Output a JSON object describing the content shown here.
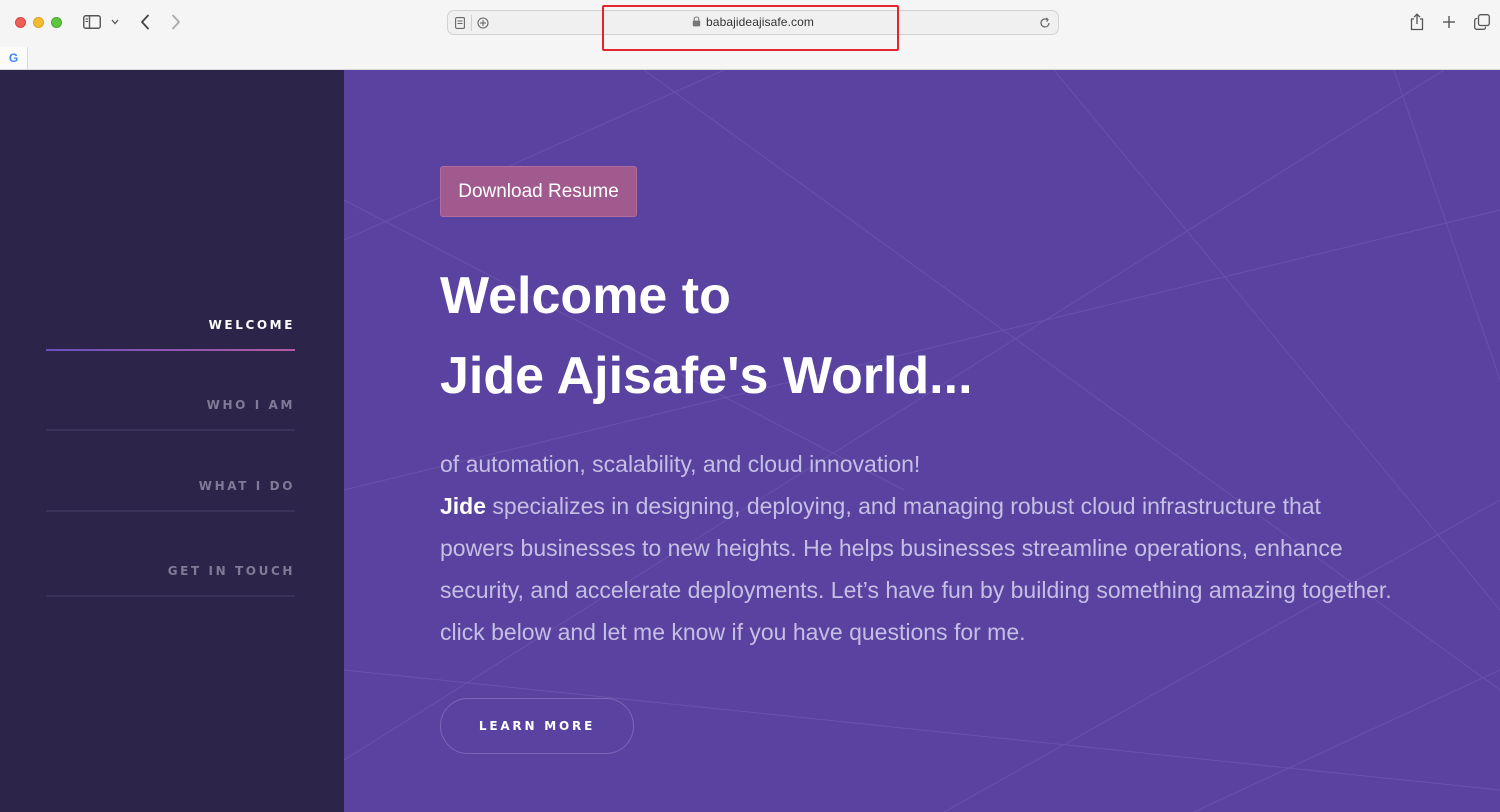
{
  "browser": {
    "url": "babajideajisafe.com",
    "favicon_letter": "G"
  },
  "sidebar": {
    "items": [
      {
        "label": "WELCOME",
        "active": true
      },
      {
        "label": "WHO I AM",
        "active": false
      },
      {
        "label": "WHAT I DO",
        "active": false
      },
      {
        "label": "GET IN TOUCH",
        "active": false
      }
    ]
  },
  "hero": {
    "resume_button": "Download Resume",
    "headline_line1": "Welcome to",
    "headline_line2": "Jide Ajisafe's World...",
    "intro_first_line": "of automation, scalability, and cloud innovation!",
    "intro_name": "Jide",
    "intro_body": " specializes in designing, deploying, and managing robust cloud infrastructure that powers businesses to new heights. He helps businesses streamline operations, enhance security, and accelerate deployments. Let’s have fun by building something amazing together. click below and let me know if you have questions for me.",
    "learn_more_button": "LEARN MORE"
  },
  "colors": {
    "sidebar_bg": "#2c2549",
    "main_bg": "#5942a0",
    "resume_button_bg": "#a05a8d",
    "highlight_box": "#e3242b"
  }
}
